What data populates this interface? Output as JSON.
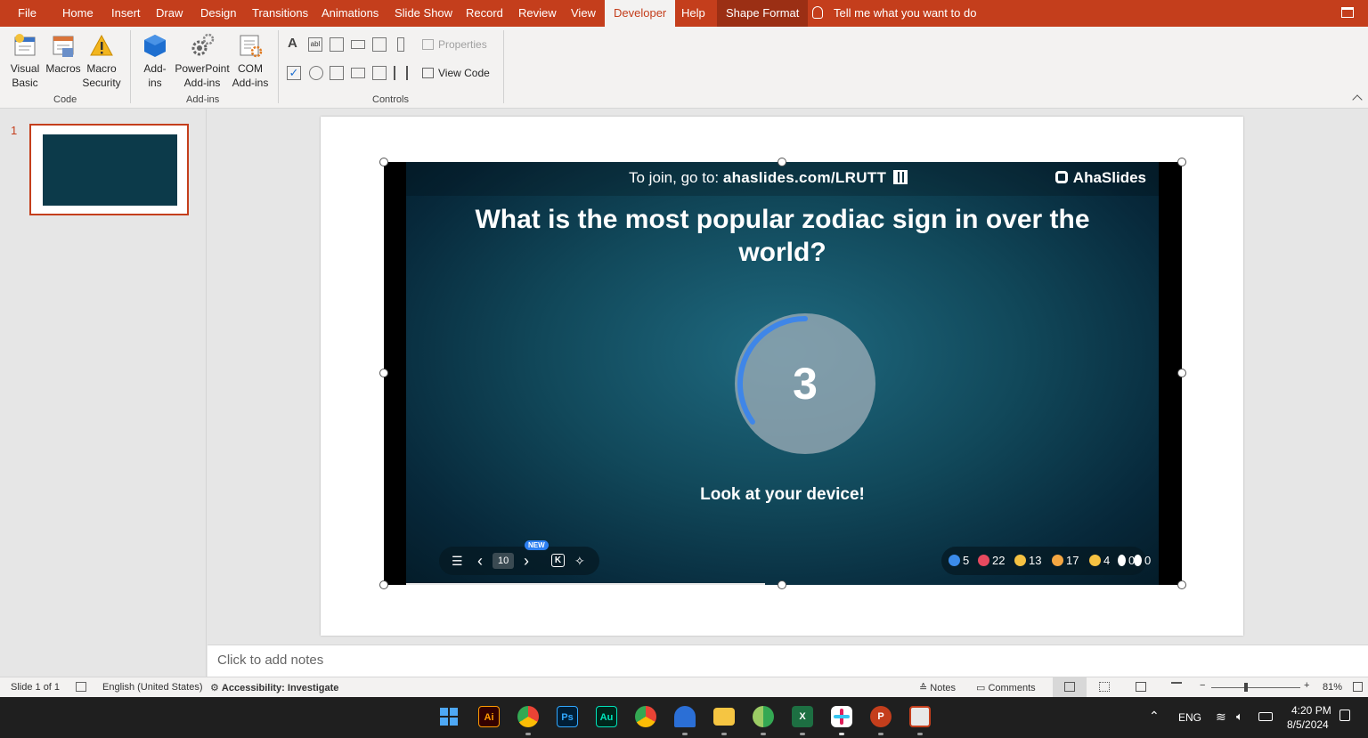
{
  "ribbon": {
    "tabs": [
      {
        "label": "File"
      },
      {
        "label": "Home"
      },
      {
        "label": "Insert"
      },
      {
        "label": "Draw"
      },
      {
        "label": "Design"
      },
      {
        "label": "Transitions"
      },
      {
        "label": "Animations"
      },
      {
        "label": "Slide Show"
      },
      {
        "label": "Record"
      },
      {
        "label": "Review"
      },
      {
        "label": "View"
      },
      {
        "label": "Developer",
        "active": true
      },
      {
        "label": "Help"
      },
      {
        "label": "Shape Format"
      }
    ],
    "tell_me": "Tell me what you want to do",
    "groups": {
      "code": {
        "label": "Code",
        "visual_basic": "Visual\nBasic",
        "visual_basic_l1": "Visual",
        "visual_basic_l2": "Basic",
        "macros": "Macros",
        "macro_security_l1": "Macro",
        "macro_security_l2": "Security"
      },
      "addins": {
        "label": "Add-ins",
        "addins_l1": "Add-",
        "addins_l2": "ins",
        "ppt_addins_l1": "PowerPoint",
        "ppt_addins_l2": "Add-ins",
        "com_addins_l1": "COM",
        "com_addins_l2": "Add-ins"
      },
      "controls": {
        "label": "Controls",
        "properties": "Properties",
        "view_code": "View Code"
      }
    }
  },
  "thumbnails": [
    {
      "number": "1"
    }
  ],
  "slide": {
    "join_prefix": "To join, go to: ",
    "join_url": "ahaslides.com/LRUTT",
    "brand": "AhaSlides",
    "question": "What is the most popular zodiac sign in over the world?",
    "timer_value": "3",
    "timer_progress": 0.35,
    "instruction": "Look at your device!",
    "nav": {
      "menu": "☰",
      "prev": "‹",
      "page": "10",
      "next": "›",
      "k_label": "K",
      "new_badge": "NEW"
    },
    "reactions": [
      {
        "name": "like",
        "count": "5",
        "color": "#3b8bea"
      },
      {
        "name": "heart",
        "count": "22",
        "color": "#e84a5f"
      },
      {
        "name": "laugh",
        "count": "13",
        "color": "#f5c242"
      },
      {
        "name": "wow",
        "count": "17",
        "color": "#f5a742"
      },
      {
        "name": "sad",
        "count": "4",
        "color": "#f5c242"
      },
      {
        "name": "clap",
        "count": "0",
        "color": "#ffffff"
      },
      {
        "name": "audience",
        "count": "0",
        "color": "#ffffff"
      }
    ]
  },
  "notes_placeholder": "Click to add notes",
  "status": {
    "slide_info": "Slide 1 of 1",
    "language": "English (United States)",
    "accessibility": "Accessibility: Investigate",
    "notes": "Notes",
    "comments": "Comments",
    "zoom": "81%"
  },
  "taskbar": {
    "apps": [
      "windows-start",
      "illustrator",
      "chrome",
      "photoshop",
      "audition",
      "chrome-alt",
      "browser",
      "file-explorer",
      "chrome-profile",
      "excel",
      "slack",
      "powerpoint",
      "snipping-tool"
    ],
    "app_labels": {
      "illustrator": "Ai",
      "photoshop": "Ps",
      "audition": "Au"
    },
    "lang": "ENG",
    "time": "4:20 PM",
    "date": "8/5/2024"
  }
}
